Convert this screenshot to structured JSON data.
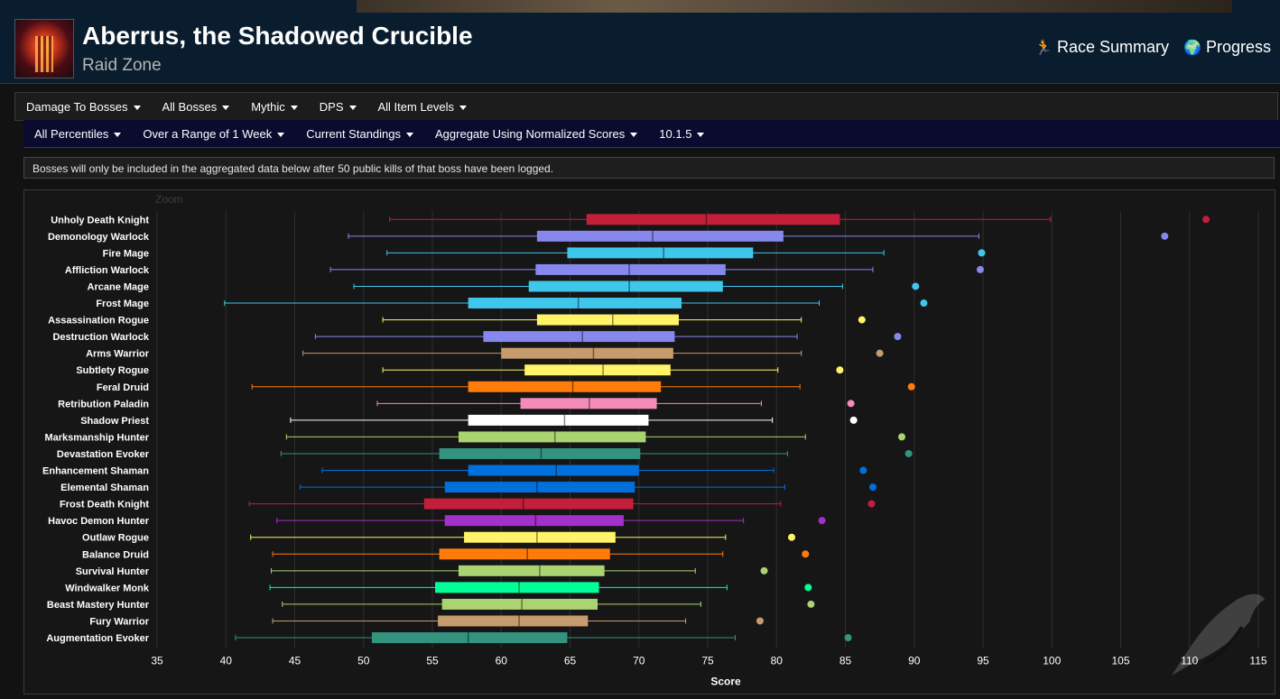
{
  "header": {
    "title": "Aberrus, the Shadowed Crucible",
    "subtitle": "Raid Zone",
    "links": [
      {
        "label": "Race Summary",
        "icon": "running-person-icon"
      },
      {
        "label": "Progress",
        "icon": "globe-icon"
      }
    ]
  },
  "filters_row1": [
    "Damage To Bosses",
    "All Bosses",
    "Mythic",
    "DPS",
    "All Item Levels"
  ],
  "filters_row2": [
    "All Percentiles",
    "Over a Range of 1 Week",
    "Current Standings",
    "Aggregate Using Normalized Scores",
    "10.1.5"
  ],
  "notice": "Bosses will only be included in the aggregated data below after 50 public kills of that boss have been logged.",
  "chart_zoom_label": "Zoom",
  "chart_data": {
    "type": "boxplot",
    "orientation": "horizontal",
    "xlabel": "Score",
    "xlim": [
      35,
      115
    ],
    "xticks": [
      35,
      40,
      45,
      50,
      55,
      60,
      65,
      70,
      75,
      80,
      85,
      90,
      95,
      100,
      105,
      110,
      115
    ],
    "grid": true,
    "series": [
      {
        "name": "Unholy Death Knight",
        "color": "#C41E3A",
        "min": 51.9,
        "q1": 66.2,
        "median": 74.9,
        "q3": 84.6,
        "max": 99.9,
        "outlier": 111.2
      },
      {
        "name": "Demonology Warlock",
        "color": "#8788EE",
        "min": 48.9,
        "q1": 62.6,
        "median": 71.0,
        "q3": 80.5,
        "max": 94.7,
        "outlier": 108.2
      },
      {
        "name": "Fire Mage",
        "color": "#3FC7EB",
        "min": 51.7,
        "q1": 64.8,
        "median": 71.8,
        "q3": 78.3,
        "max": 87.8,
        "outlier": 94.9
      },
      {
        "name": "Affliction Warlock",
        "color": "#8788EE",
        "min": 47.6,
        "q1": 62.5,
        "median": 69.3,
        "q3": 76.3,
        "max": 87.0,
        "outlier": 94.8
      },
      {
        "name": "Arcane Mage",
        "color": "#3FC7EB",
        "min": 49.3,
        "q1": 62.0,
        "median": 69.3,
        "q3": 76.1,
        "max": 84.8,
        "outlier": 90.1
      },
      {
        "name": "Frost Mage",
        "color": "#3FC7EB",
        "min": 39.9,
        "q1": 57.6,
        "median": 65.6,
        "q3": 73.1,
        "max": 83.1,
        "outlier": 90.7
      },
      {
        "name": "Assassination Rogue",
        "color": "#FFF468",
        "min": 51.4,
        "q1": 62.6,
        "median": 68.1,
        "q3": 72.9,
        "max": 81.8,
        "outlier": 86.2
      },
      {
        "name": "Destruction Warlock",
        "color": "#8788EE",
        "min": 46.5,
        "q1": 58.7,
        "median": 65.9,
        "q3": 72.6,
        "max": 81.5,
        "outlier": 88.8
      },
      {
        "name": "Arms Warrior",
        "color": "#C69B6D",
        "min": 45.6,
        "q1": 60.0,
        "median": 66.7,
        "q3": 72.5,
        "max": 81.8,
        "outlier": 87.5
      },
      {
        "name": "Subtlety Rogue",
        "color": "#FFF468",
        "min": 51.4,
        "q1": 61.7,
        "median": 67.4,
        "q3": 72.3,
        "max": 80.1,
        "outlier": 84.6
      },
      {
        "name": "Feral Druid",
        "color": "#FF7C0A",
        "min": 41.9,
        "q1": 57.6,
        "median": 65.2,
        "q3": 71.6,
        "max": 81.7,
        "outlier": 89.8
      },
      {
        "name": "Retribution Paladin",
        "color": "#F48CBA",
        "min": 51.0,
        "q1": 61.4,
        "median": 66.4,
        "q3": 71.3,
        "max": 78.9,
        "outlier": 85.4
      },
      {
        "name": "Shadow Priest",
        "color": "#FFFFFF",
        "min": 44.7,
        "q1": 57.6,
        "median": 64.6,
        "q3": 70.7,
        "max": 79.7,
        "outlier": 85.6
      },
      {
        "name": "Marksmanship Hunter",
        "color": "#AAD372",
        "min": 44.4,
        "q1": 56.9,
        "median": 63.9,
        "q3": 70.5,
        "max": 82.1,
        "outlier": 89.1
      },
      {
        "name": "Devastation Evoker",
        "color": "#33937F",
        "min": 44.0,
        "q1": 55.5,
        "median": 62.9,
        "q3": 70.1,
        "max": 80.8,
        "outlier": 89.6
      },
      {
        "name": "Enhancement Shaman",
        "color": "#0070DD",
        "min": 47.0,
        "q1": 57.6,
        "median": 64.0,
        "q3": 70.0,
        "max": 79.8,
        "outlier": 86.3
      },
      {
        "name": "Elemental Shaman",
        "color": "#0070DD",
        "min": 45.4,
        "q1": 55.9,
        "median": 62.6,
        "q3": 69.7,
        "max": 80.6,
        "outlier": 87.0
      },
      {
        "name": "Frost Death Knight",
        "color": "#C41E3A",
        "min": 41.7,
        "q1": 54.4,
        "median": 61.6,
        "q3": 69.6,
        "max": 80.3,
        "outlier": 86.9
      },
      {
        "name": "Havoc Demon Hunter",
        "color": "#A330C9",
        "min": 43.7,
        "q1": 55.9,
        "median": 62.5,
        "q3": 68.9,
        "max": 77.6,
        "outlier": 83.3
      },
      {
        "name": "Outlaw Rogue",
        "color": "#FFF468",
        "min": 41.8,
        "q1": 57.3,
        "median": 62.6,
        "q3": 68.3,
        "max": 76.3,
        "outlier": 81.1
      },
      {
        "name": "Balance Druid",
        "color": "#FF7C0A",
        "min": 43.4,
        "q1": 55.5,
        "median": 61.9,
        "q3": 67.9,
        "max": 76.1,
        "outlier": 82.1
      },
      {
        "name": "Survival Hunter",
        "color": "#AAD372",
        "min": 43.3,
        "q1": 56.9,
        "median": 62.8,
        "q3": 67.5,
        "max": 74.1,
        "outlier": 79.1
      },
      {
        "name": "Windwalker Monk",
        "color": "#00FF98",
        "min": 43.2,
        "q1": 55.2,
        "median": 61.3,
        "q3": 67.1,
        "max": 76.4,
        "outlier": 82.3
      },
      {
        "name": "Beast Mastery Hunter",
        "color": "#AAD372",
        "min": 44.1,
        "q1": 55.7,
        "median": 61.5,
        "q3": 67.0,
        "max": 74.5,
        "outlier": 82.5
      },
      {
        "name": "Fury Warrior",
        "color": "#C69B6D",
        "min": 43.4,
        "q1": 55.4,
        "median": 61.3,
        "q3": 66.3,
        "max": 73.4,
        "outlier": 78.8
      },
      {
        "name": "Augmentation Evoker",
        "color": "#33937F",
        "min": 40.7,
        "q1": 50.6,
        "median": 57.6,
        "q3": 64.8,
        "max": 77.0,
        "outlier": 85.2
      }
    ]
  }
}
